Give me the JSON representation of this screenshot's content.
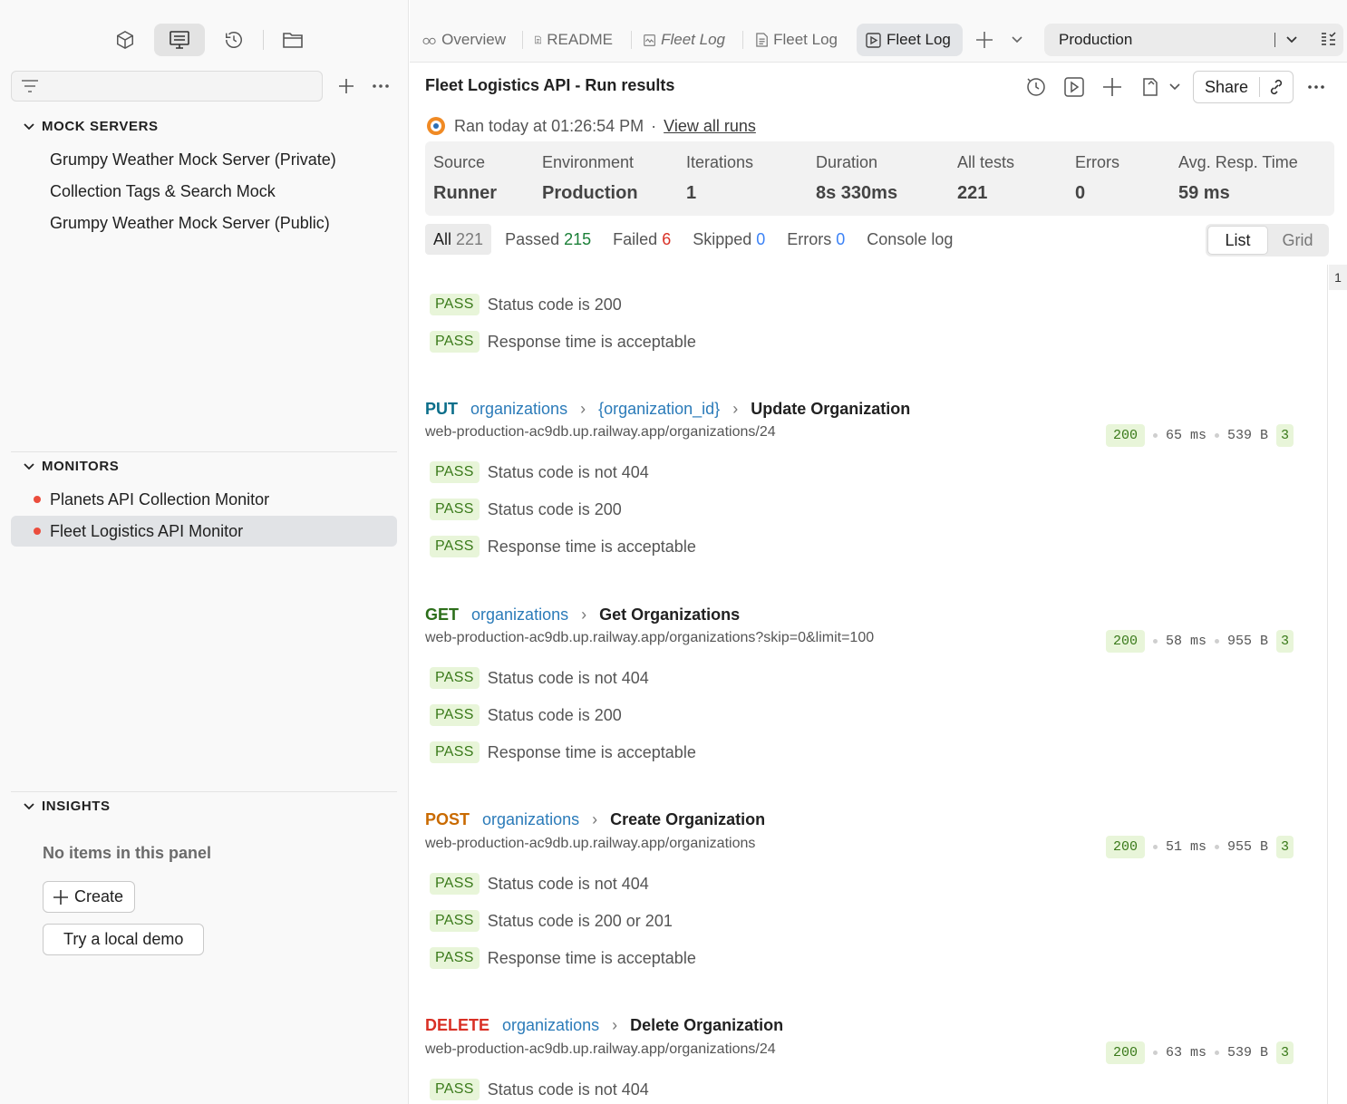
{
  "sidebar": {
    "filter_placeholder": "",
    "sections": {
      "mock_servers": {
        "title": "MOCK SERVERS",
        "items": [
          "Grumpy Weather Mock Server (Private)",
          "Collection Tags & Search Mock",
          "Grumpy Weather Mock Server (Public)"
        ]
      },
      "monitors": {
        "title": "MONITORS",
        "items": [
          "Planets API Collection Monitor",
          "Fleet Logistics API Monitor"
        ]
      },
      "insights": {
        "title": "INSIGHTS",
        "empty": "No items in this panel",
        "create_label": "Create",
        "demo_label": "Try a local demo"
      }
    }
  },
  "tabs": [
    {
      "label": "Overview",
      "icon": "overview-icon"
    },
    {
      "label": "README",
      "icon": "doc-icon"
    },
    {
      "label": "Fleet Log",
      "icon": "monitor-icon"
    },
    {
      "label": "Fleet Log",
      "icon": "doc-icon"
    },
    {
      "label": "Fleet Log",
      "icon": "runner-icon"
    }
  ],
  "environment": {
    "selected": "Production"
  },
  "run": {
    "title": "Fleet Logistics API - Run results",
    "ran_text": "Ran today at 01:26:54 PM",
    "view_all": "View all runs",
    "share_label": "Share"
  },
  "stats": [
    {
      "label": "Source",
      "value": "Runner"
    },
    {
      "label": "Environment",
      "value": "Production"
    },
    {
      "label": "Iterations",
      "value": "1"
    },
    {
      "label": "Duration",
      "value": "8s 330ms"
    },
    {
      "label": "All tests",
      "value": "221"
    },
    {
      "label": "Errors",
      "value": "0"
    },
    {
      "label": "Avg. Resp. Time",
      "value": "59 ms"
    }
  ],
  "filters": [
    {
      "label": "All",
      "count": "221"
    },
    {
      "label": "Passed",
      "count": "215"
    },
    {
      "label": "Failed",
      "count": "6"
    },
    {
      "label": "Skipped",
      "count": "0"
    },
    {
      "label": "Errors",
      "count": "0"
    },
    {
      "label": "Console log",
      "count": ""
    }
  ],
  "view_toggle": {
    "list": "List",
    "grid": "Grid"
  },
  "scroll_badge": "1",
  "pass_label": "PASS",
  "orphan_tests": [
    "Status code is 200",
    "Response time is acceptable"
  ],
  "requests": [
    {
      "method": "PUT",
      "crumbs": [
        "organizations",
        "{organization_id}"
      ],
      "name": "Update Organization",
      "url": "web-production-ac9db.up.railway.app/organizations/24",
      "status": "200",
      "time": "65 ms",
      "size": "539 B",
      "count": "3",
      "tests": [
        "Status code is not 404",
        "Status code is 200",
        "Response time is acceptable"
      ]
    },
    {
      "method": "GET",
      "crumbs": [
        "organizations"
      ],
      "name": "Get Organizations",
      "url": "web-production-ac9db.up.railway.app/organizations?skip=0&limit=100",
      "status": "200",
      "time": "58 ms",
      "size": "955 B",
      "count": "3",
      "tests": [
        "Status code is not 404",
        "Status code is 200",
        "Response time is acceptable"
      ]
    },
    {
      "method": "POST",
      "crumbs": [
        "organizations"
      ],
      "name": "Create Organization",
      "url": "web-production-ac9db.up.railway.app/organizations",
      "status": "200",
      "time": "51 ms",
      "size": "955 B",
      "count": "3",
      "tests": [
        "Status code is not 404",
        "Status code is 200 or 201",
        "Response time is acceptable"
      ]
    },
    {
      "method": "DELETE",
      "crumbs": [
        "organizations"
      ],
      "name": "Delete Organization",
      "url": "web-production-ac9db.up.railway.app/organizations/24",
      "status": "200",
      "time": "63 ms",
      "size": "539 B",
      "count": "3",
      "tests": [
        "Status code is not 404"
      ]
    }
  ]
}
